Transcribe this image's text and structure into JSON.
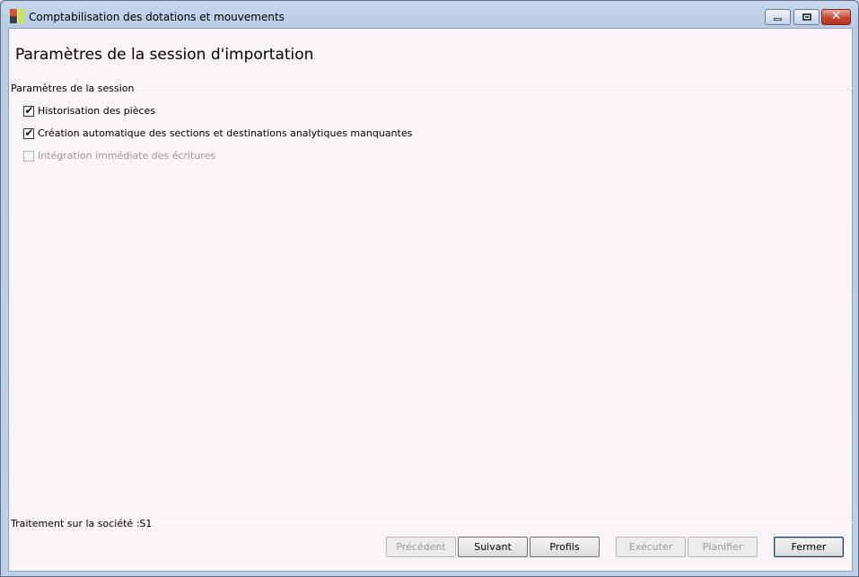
{
  "window": {
    "title": "Comptabilisation des dotations et mouvements",
    "minimize_label": "",
    "close_label": "✕"
  },
  "page": {
    "heading": "Paramètres de la session d'importation"
  },
  "group": {
    "label": "Paramètres de la session",
    "options": [
      {
        "label": "Historisation des pièces",
        "checked": true,
        "enabled": true
      },
      {
        "label": "Création automatique des sections et destinations analytiques manquantes",
        "checked": true,
        "enabled": true
      },
      {
        "label": "Intégration immédiate des écritures",
        "checked": false,
        "enabled": false
      }
    ]
  },
  "footer": {
    "company_label": "Traitement sur la société :S1"
  },
  "buttons": {
    "previous": {
      "label": "Précédent",
      "enabled": false
    },
    "next": {
      "label": "Suivant",
      "enabled": true
    },
    "profiles": {
      "label": "Profils",
      "enabled": true
    },
    "execute": {
      "label": "Exécuter",
      "enabled": false
    },
    "schedule": {
      "label": "Planifier",
      "enabled": false
    },
    "close": {
      "label": "Fermer",
      "enabled": true
    }
  },
  "check_mark": "✔"
}
